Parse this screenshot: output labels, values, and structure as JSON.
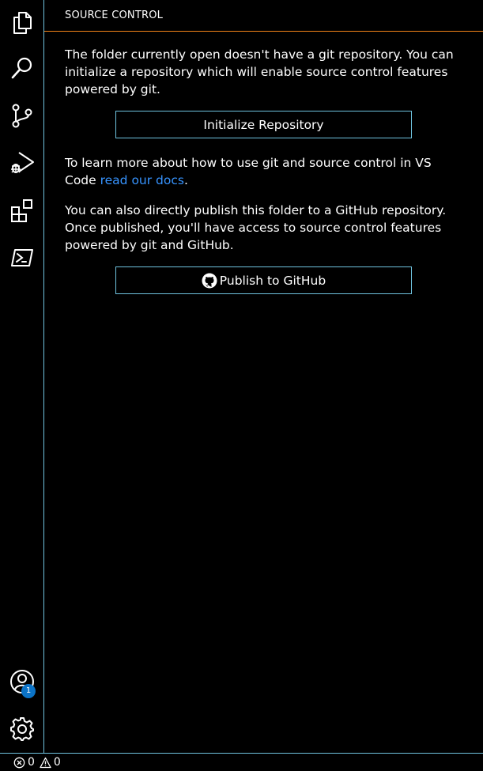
{
  "activity_bar": {
    "items": [
      {
        "name": "explorer",
        "icon": "files-icon"
      },
      {
        "name": "search",
        "icon": "search-icon"
      },
      {
        "name": "source-control",
        "icon": "source-control-icon"
      },
      {
        "name": "run-and-debug",
        "icon": "run-debug-icon"
      },
      {
        "name": "extensions",
        "icon": "extensions-icon"
      },
      {
        "name": "powershell",
        "icon": "terminal-icon"
      }
    ],
    "accounts": {
      "icon": "account-icon",
      "badge": "1"
    },
    "manage": {
      "icon": "gear-icon"
    }
  },
  "panel": {
    "title": "SOURCE CONTROL",
    "intro_text": "The folder currently open doesn't have a git repository. You can initialize a repository which will enable source control features powered by git.",
    "init_button_label": "Initialize Repository",
    "learn_text": "To learn more about how to use git and source control in VS Code ",
    "learn_link": "read our docs",
    "learn_suffix": ".",
    "publish_text": "You can also directly publish this folder to a GitHub repository. Once published, you'll have access to source control features powered by git and GitHub.",
    "publish_button_label": "Publish to GitHub",
    "publish_button_icon": "github-icon"
  },
  "status_bar": {
    "errors": "0",
    "warnings": "0",
    "error_icon": "error-icon",
    "warning_icon": "warning-icon"
  },
  "colors": {
    "contrast_border": "#6fc3df",
    "active_border": "#f38518",
    "link": "#3794ff",
    "badge": "#0b73c7"
  }
}
